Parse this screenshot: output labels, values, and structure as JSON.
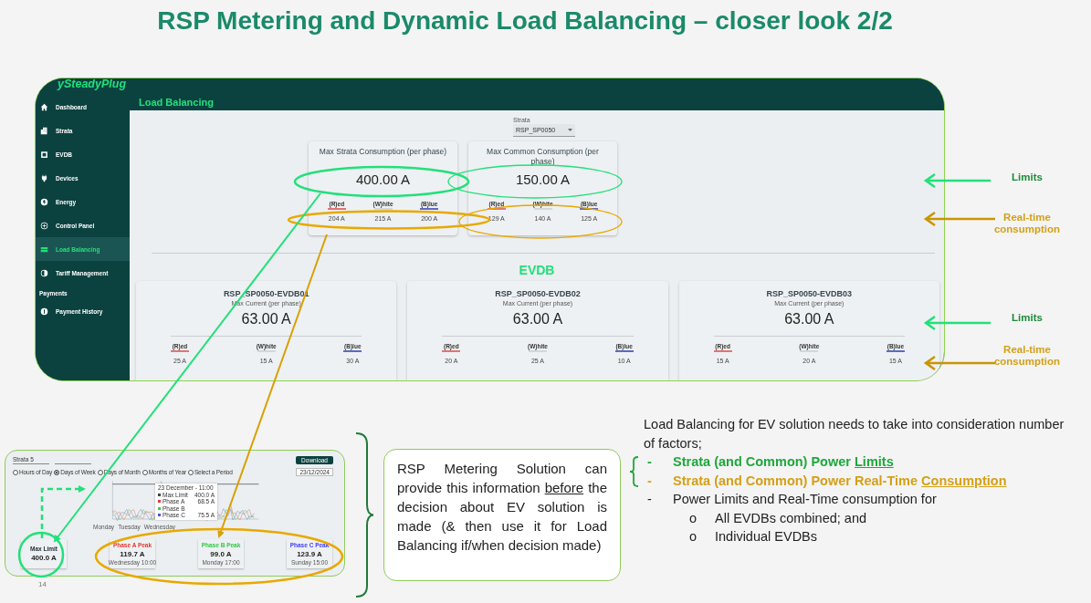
{
  "title": "RSP Metering and Dynamic Load Balancing – closer look 2/2",
  "app": {
    "logo": "ySteadyPlug",
    "sidebar": [
      {
        "kind": "item",
        "label": "Dashboard",
        "selected": false
      },
      {
        "kind": "item",
        "label": "Strata",
        "selected": false
      },
      {
        "kind": "item",
        "label": "EVDB",
        "selected": false
      },
      {
        "kind": "item",
        "label": "Devices",
        "selected": false
      },
      {
        "kind": "item",
        "label": "Energy",
        "selected": false
      },
      {
        "kind": "item",
        "label": "Control Panel",
        "selected": false
      },
      {
        "kind": "item",
        "label": "Load Balancing",
        "selected": true
      },
      {
        "kind": "item",
        "label": "Tariff Management",
        "selected": false
      },
      {
        "kind": "heading",
        "label": "Payments"
      },
      {
        "kind": "item",
        "label": "Payment History",
        "selected": false
      }
    ],
    "page_title": "Load Balancing",
    "strata_select": {
      "label": "Strata",
      "value": "RSP_SP0050"
    },
    "summary_cards": [
      {
        "title": "Max Strata Consumption (per phase)",
        "value": "400.00 A",
        "phases": [
          {
            "label": "(R)ed",
            "reading": "204 A",
            "color": "#e57373"
          },
          {
            "label": "(W)hite",
            "reading": "215 A",
            "color": "#cfd8dc"
          },
          {
            "label": "(B)lue",
            "reading": "200 A",
            "color": "#5c6bc0"
          }
        ]
      },
      {
        "title": "Max Common Consumption (per phase)",
        "value": "150.00 A",
        "phases": [
          {
            "label": "(R)ed",
            "reading": "129 A",
            "color": "#e57373"
          },
          {
            "label": "(W)hite",
            "reading": "140 A",
            "color": "#cfd8dc"
          },
          {
            "label": "(B)lue",
            "reading": "125 A",
            "color": "#5c6bc0"
          }
        ]
      }
    ],
    "evdb_heading": "EVDB",
    "evdb_cards": [
      {
        "name": "RSP_SP0050-EVDB01",
        "subtitle": "Max Current (per phase)",
        "value": "63.00 A",
        "phases": [
          {
            "label": "(R)ed",
            "reading": "25 A",
            "color": "#e57373"
          },
          {
            "label": "(W)hite",
            "reading": "15 A",
            "color": "#cfd8dc"
          },
          {
            "label": "(B)lue",
            "reading": "30 A",
            "color": "#5c6bc0"
          }
        ]
      },
      {
        "name": "RSP_SP0050-EVDB02",
        "subtitle": "Max Current (per phase)",
        "value": "63.00 A",
        "phases": [
          {
            "label": "(R)ed",
            "reading": "20 A",
            "color": "#e57373"
          },
          {
            "label": "(W)hite",
            "reading": "25 A",
            "color": "#cfd8dc"
          },
          {
            "label": "(B)lue",
            "reading": "10 A",
            "color": "#5c6bc0"
          }
        ]
      },
      {
        "name": "RSP_SP0050-EVDB03",
        "subtitle": "Max Current (per phase)",
        "value": "63.00 A",
        "phases": [
          {
            "label": "(R)ed",
            "reading": "15 A",
            "color": "#e57373"
          },
          {
            "label": "(W)hite",
            "reading": "20 A",
            "color": "#cfd8dc"
          },
          {
            "label": "(B)lue",
            "reading": "15 A",
            "color": "#5c6bc0"
          }
        ]
      }
    ]
  },
  "annotations": [
    {
      "kind": "limit",
      "text": "Limits"
    },
    {
      "kind": "consumption",
      "text": "Real-time consumption"
    },
    {
      "kind": "limit",
      "text": "Limits"
    },
    {
      "kind": "consumption",
      "text": "Real-time consumption"
    }
  ],
  "mini_dashboard": {
    "select_value": "Strata 5",
    "download": "Download",
    "date": "23/12/2024",
    "periods": [
      {
        "label": "Hours of Day",
        "selected": false
      },
      {
        "label": "Days of Week",
        "selected": true
      },
      {
        "label": "Days of Month",
        "selected": false
      },
      {
        "label": "Months of Year",
        "selected": false
      },
      {
        "label": "Select a Period",
        "selected": false
      }
    ],
    "x_labels": [
      "Monday",
      "Tuesday",
      "Wednesday"
    ],
    "tooltip": {
      "header": "23 December - 11:00",
      "rows": [
        {
          "label": "Max Limit",
          "value": "400.0 A",
          "color": "#37474f"
        },
        {
          "label": "Phase A",
          "value": "68.5 A",
          "color": "#e53935"
        },
        {
          "label": "Phase B",
          "color": "#43c943"
        },
        {
          "label": "Phase C",
          "value": "75.5 A",
          "color": "#5050f0"
        }
      ]
    },
    "stats": [
      {
        "label": "Max Limit",
        "value": "400.0 A",
        "color": "#263238"
      },
      {
        "label": "Phase A Peak",
        "value": "119.7 A",
        "sub": "Wednesday 10:00",
        "color": "#e53935"
      },
      {
        "label": "Phase B Peak",
        "value": "99.0 A",
        "sub": "Monday 17:00",
        "color": "#2ecc40"
      },
      {
        "label": "Phase C Peak",
        "value": "123.9 A",
        "sub": "Sunday 15:00",
        "color": "#3d3dff"
      }
    ]
  },
  "callout_box": {
    "segments": [
      {
        "text": "RSP Metering Solution can provide this information ",
        "underline": false
      },
      {
        "text": "before",
        "underline": true
      },
      {
        "text": " the decision about EV solution is made (& then use it for Load Balancing if/when decision made)",
        "underline": false
      }
    ]
  },
  "notes": {
    "intro": "Load Balancing for EV solution needs to take into consideration number of factors;",
    "items": [
      {
        "marker": "-",
        "bold": true,
        "color": "#1ea83c",
        "segments": [
          {
            "text": "Strata (and Common) Power ",
            "underline": false
          },
          {
            "text": "Limits",
            "underline": true
          }
        ]
      },
      {
        "marker": "-",
        "bold": true,
        "color": "#d4a017",
        "segments": [
          {
            "text": "Strata (and Common) Power Real-Time ",
            "underline": false
          },
          {
            "text": "Consumption",
            "underline": true
          }
        ]
      },
      {
        "marker": "-",
        "bold": false,
        "color": "#222222",
        "segments": [
          {
            "text": "Power Limits and Real-Time consumption for",
            "underline": false
          }
        ],
        "children": [
          {
            "marker": "o",
            "text": "All EVDBs combined; and"
          },
          {
            "marker": "o",
            "text": "Individual EVDBs"
          }
        ]
      }
    ]
  },
  "page_number": "14"
}
